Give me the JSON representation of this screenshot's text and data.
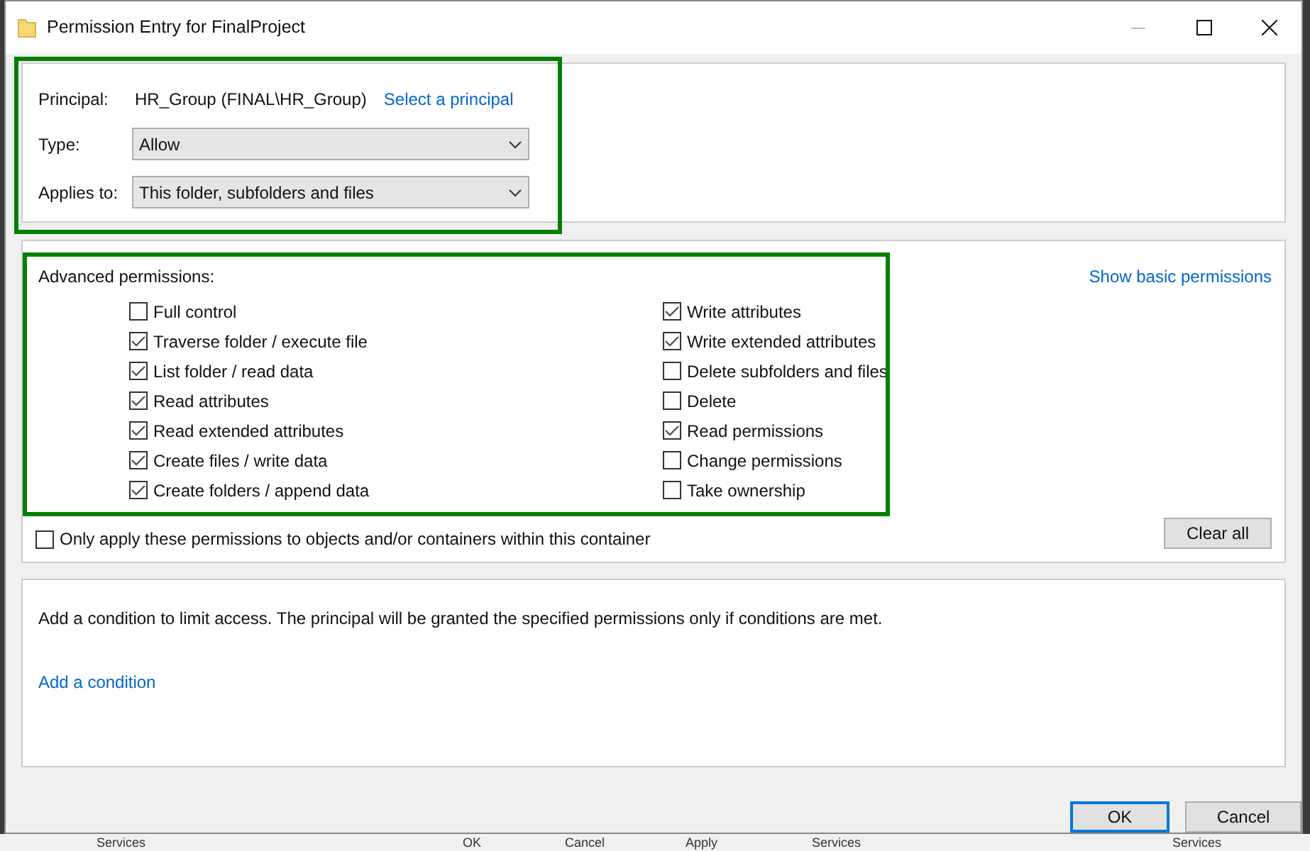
{
  "window": {
    "title": "Permission Entry for FinalProject"
  },
  "principal_section": {
    "highlighted": true,
    "principal_label": "Principal:",
    "principal": "HR_Group (FINAL\\HR_Group)",
    "select_link": "Select a principal",
    "type_label": "Type:",
    "type_value": "Allow",
    "applies_label": "Applies to:",
    "applies_value": "This folder, subfolders and files"
  },
  "permissions_section": {
    "highlighted": true,
    "heading": "Advanced permissions:",
    "show_basic_link": "Show basic permissions",
    "left_column": [
      {
        "label": "Full control",
        "checked": false
      },
      {
        "label": "Traverse folder / execute file",
        "checked": true
      },
      {
        "label": "List folder / read data",
        "checked": true
      },
      {
        "label": "Read attributes",
        "checked": true
      },
      {
        "label": "Read extended attributes",
        "checked": true
      },
      {
        "label": "Create files / write data",
        "checked": true
      },
      {
        "label": "Create folders / append data",
        "checked": true
      }
    ],
    "right_column": [
      {
        "label": "Write attributes",
        "checked": true
      },
      {
        "label": "Write extended attributes",
        "checked": true
      },
      {
        "label": "Delete subfolders and files",
        "checked": false
      },
      {
        "label": "Delete",
        "checked": false
      },
      {
        "label": "Read permissions",
        "checked": true
      },
      {
        "label": "Change permissions",
        "checked": false
      },
      {
        "label": "Take ownership",
        "checked": false
      }
    ],
    "only_apply": {
      "label": "Only apply these permissions to objects and/or containers within this container",
      "checked": false
    },
    "clear_button": "Clear all"
  },
  "condition_section": {
    "text": "Add a condition to limit access. The principal will be granted the specified permissions only if conditions are met.",
    "link": "Add a condition"
  },
  "buttons": [
    "OK",
    "Cancel"
  ],
  "background_window": {
    "labels": [
      "Services",
      "OK",
      "Cancel",
      "Apply",
      "Services",
      "Services"
    ]
  }
}
